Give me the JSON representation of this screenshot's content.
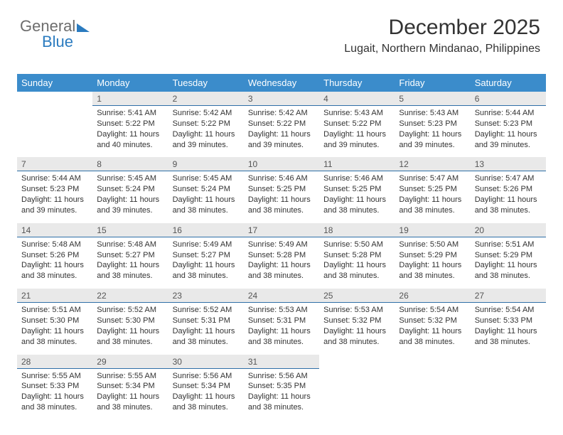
{
  "brand": {
    "part1": "General",
    "part2": "Blue"
  },
  "header": {
    "title": "December 2025",
    "subtitle": "Lugait, Northern Mindanao, Philippines"
  },
  "weekdays": [
    "Sunday",
    "Monday",
    "Tuesday",
    "Wednesday",
    "Thursday",
    "Friday",
    "Saturday"
  ],
  "weeks": [
    [
      null,
      {
        "n": "1",
        "sr": "5:41 AM",
        "ss": "5:22 PM",
        "dl": "11 hours and 40 minutes."
      },
      {
        "n": "2",
        "sr": "5:42 AM",
        "ss": "5:22 PM",
        "dl": "11 hours and 39 minutes."
      },
      {
        "n": "3",
        "sr": "5:42 AM",
        "ss": "5:22 PM",
        "dl": "11 hours and 39 minutes."
      },
      {
        "n": "4",
        "sr": "5:43 AM",
        "ss": "5:22 PM",
        "dl": "11 hours and 39 minutes."
      },
      {
        "n": "5",
        "sr": "5:43 AM",
        "ss": "5:23 PM",
        "dl": "11 hours and 39 minutes."
      },
      {
        "n": "6",
        "sr": "5:44 AM",
        "ss": "5:23 PM",
        "dl": "11 hours and 39 minutes."
      }
    ],
    [
      {
        "n": "7",
        "sr": "5:44 AM",
        "ss": "5:23 PM",
        "dl": "11 hours and 39 minutes."
      },
      {
        "n": "8",
        "sr": "5:45 AM",
        "ss": "5:24 PM",
        "dl": "11 hours and 39 minutes."
      },
      {
        "n": "9",
        "sr": "5:45 AM",
        "ss": "5:24 PM",
        "dl": "11 hours and 38 minutes."
      },
      {
        "n": "10",
        "sr": "5:46 AM",
        "ss": "5:25 PM",
        "dl": "11 hours and 38 minutes."
      },
      {
        "n": "11",
        "sr": "5:46 AM",
        "ss": "5:25 PM",
        "dl": "11 hours and 38 minutes."
      },
      {
        "n": "12",
        "sr": "5:47 AM",
        "ss": "5:25 PM",
        "dl": "11 hours and 38 minutes."
      },
      {
        "n": "13",
        "sr": "5:47 AM",
        "ss": "5:26 PM",
        "dl": "11 hours and 38 minutes."
      }
    ],
    [
      {
        "n": "14",
        "sr": "5:48 AM",
        "ss": "5:26 PM",
        "dl": "11 hours and 38 minutes."
      },
      {
        "n": "15",
        "sr": "5:48 AM",
        "ss": "5:27 PM",
        "dl": "11 hours and 38 minutes."
      },
      {
        "n": "16",
        "sr": "5:49 AM",
        "ss": "5:27 PM",
        "dl": "11 hours and 38 minutes."
      },
      {
        "n": "17",
        "sr": "5:49 AM",
        "ss": "5:28 PM",
        "dl": "11 hours and 38 minutes."
      },
      {
        "n": "18",
        "sr": "5:50 AM",
        "ss": "5:28 PM",
        "dl": "11 hours and 38 minutes."
      },
      {
        "n": "19",
        "sr": "5:50 AM",
        "ss": "5:29 PM",
        "dl": "11 hours and 38 minutes."
      },
      {
        "n": "20",
        "sr": "5:51 AM",
        "ss": "5:29 PM",
        "dl": "11 hours and 38 minutes."
      }
    ],
    [
      {
        "n": "21",
        "sr": "5:51 AM",
        "ss": "5:30 PM",
        "dl": "11 hours and 38 minutes."
      },
      {
        "n": "22",
        "sr": "5:52 AM",
        "ss": "5:30 PM",
        "dl": "11 hours and 38 minutes."
      },
      {
        "n": "23",
        "sr": "5:52 AM",
        "ss": "5:31 PM",
        "dl": "11 hours and 38 minutes."
      },
      {
        "n": "24",
        "sr": "5:53 AM",
        "ss": "5:31 PM",
        "dl": "11 hours and 38 minutes."
      },
      {
        "n": "25",
        "sr": "5:53 AM",
        "ss": "5:32 PM",
        "dl": "11 hours and 38 minutes."
      },
      {
        "n": "26",
        "sr": "5:54 AM",
        "ss": "5:32 PM",
        "dl": "11 hours and 38 minutes."
      },
      {
        "n": "27",
        "sr": "5:54 AM",
        "ss": "5:33 PM",
        "dl": "11 hours and 38 minutes."
      }
    ],
    [
      {
        "n": "28",
        "sr": "5:55 AM",
        "ss": "5:33 PM",
        "dl": "11 hours and 38 minutes."
      },
      {
        "n": "29",
        "sr": "5:55 AM",
        "ss": "5:34 PM",
        "dl": "11 hours and 38 minutes."
      },
      {
        "n": "30",
        "sr": "5:56 AM",
        "ss": "5:34 PM",
        "dl": "11 hours and 38 minutes."
      },
      {
        "n": "31",
        "sr": "5:56 AM",
        "ss": "5:35 PM",
        "dl": "11 hours and 38 minutes."
      },
      null,
      null,
      null
    ]
  ],
  "labels": {
    "sunrise": "Sunrise: ",
    "sunset": "Sunset: ",
    "daylight": "Daylight: "
  }
}
